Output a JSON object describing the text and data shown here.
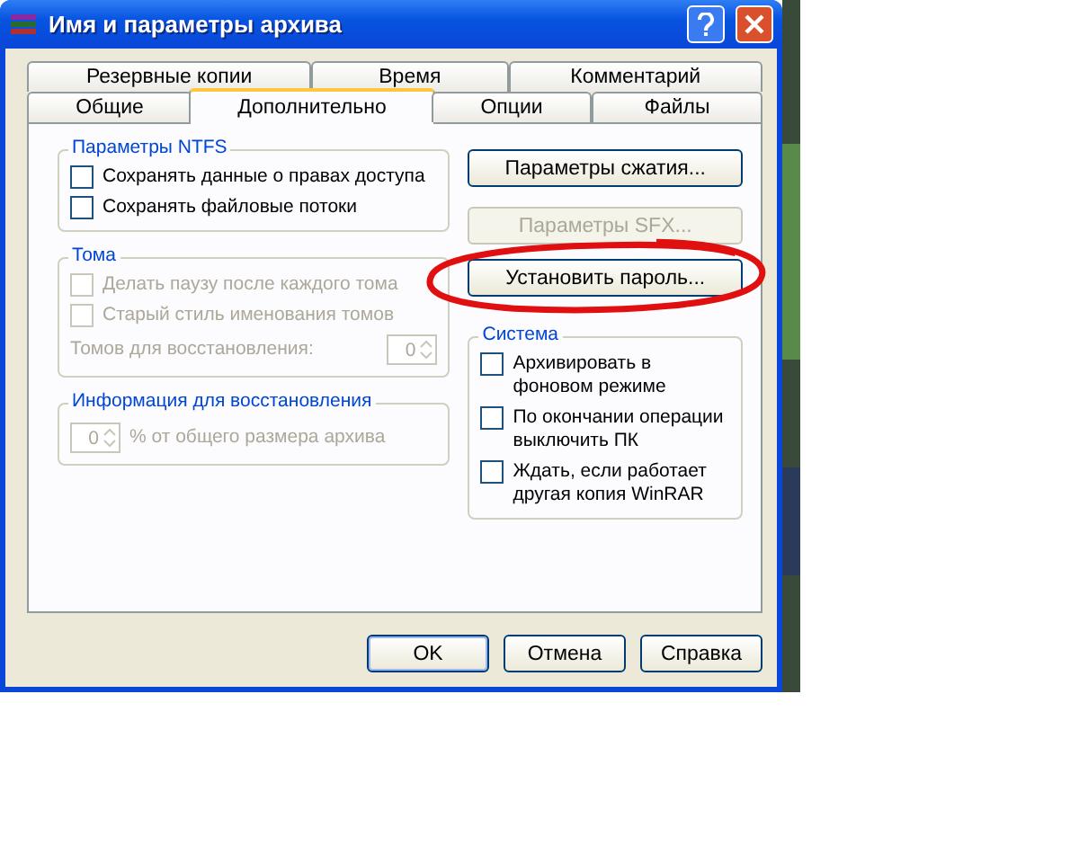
{
  "window": {
    "title": "Имя и параметры архива"
  },
  "tab_rows": [
    [
      {
        "label": "Резервные копии",
        "selected": false
      },
      {
        "label": "Время",
        "selected": false
      },
      {
        "label": "Комментарий",
        "selected": false
      }
    ],
    [
      {
        "label": "Общие",
        "selected": false
      },
      {
        "label": "Дополнительно",
        "selected": true
      },
      {
        "label": "Опции",
        "selected": false
      },
      {
        "label": "Файлы",
        "selected": false
      }
    ]
  ],
  "ntfs": {
    "title": "Параметры NTFS",
    "options": [
      {
        "label": "Сохранять данные о правах доступа",
        "checked": false,
        "disabled": false
      },
      {
        "label": "Сохранять файловые потоки",
        "checked": false,
        "disabled": false
      }
    ]
  },
  "volumes": {
    "title": "Тома",
    "options": [
      {
        "label": "Делать паузу после каждого тома",
        "checked": false,
        "disabled": true
      },
      {
        "label": "Старый стиль именования томов",
        "checked": false,
        "disabled": true
      }
    ],
    "recovery_volumes": {
      "label": "Томов для восстановления:",
      "value": "0",
      "disabled": true
    }
  },
  "recovery": {
    "title": "Информация для восстановления",
    "value": "0",
    "suffix": "% от общего размера архива",
    "disabled": true
  },
  "actions": [
    {
      "label": "Параметры сжатия...",
      "disabled": false,
      "circled": false
    },
    {
      "label": "Параметры SFX...",
      "disabled": true,
      "circled": false
    },
    {
      "label": "Установить пароль...",
      "disabled": false,
      "circled": true
    }
  ],
  "system": {
    "title": "Система",
    "options": [
      {
        "label": "Архивировать в фоновом режиме",
        "checked": false,
        "disabled": false
      },
      {
        "label": "По окончании операции выключить ПК",
        "checked": false,
        "disabled": false
      },
      {
        "label": "Ждать, если работает другая копия WinRAR",
        "checked": false,
        "disabled": false
      }
    ]
  },
  "buttons": [
    {
      "label": "OK",
      "default": true
    },
    {
      "label": "Отмена",
      "default": false
    },
    {
      "label": "Справка",
      "default": false
    }
  ]
}
